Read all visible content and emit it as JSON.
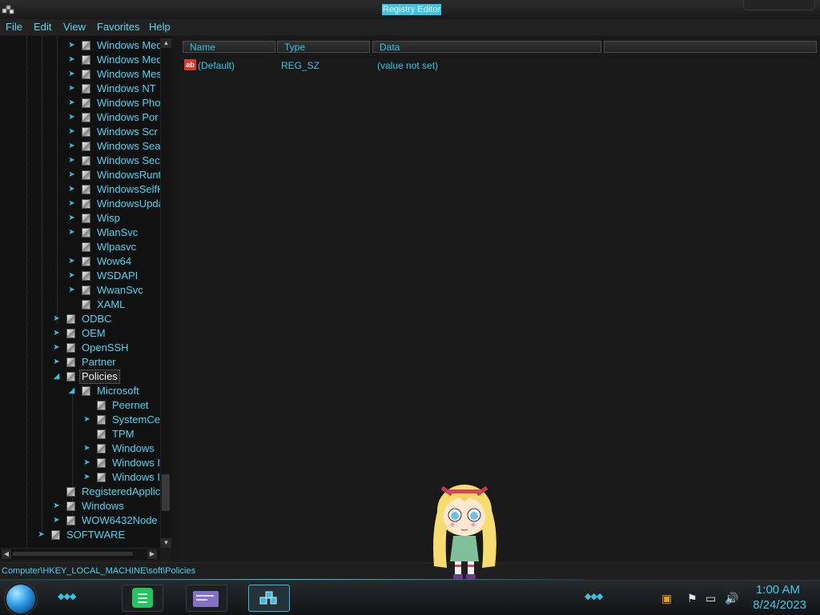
{
  "window": {
    "title": "Registry Editor"
  },
  "menu": [
    "File",
    "Edit",
    "View",
    "Favorites",
    "Help"
  ],
  "tree": {
    "nodes": [
      {
        "label": "Windows Med",
        "depth": 3,
        "expander": "collapsed"
      },
      {
        "label": "Windows Med",
        "depth": 3,
        "expander": "collapsed"
      },
      {
        "label": "Windows Mes",
        "depth": 3,
        "expander": "collapsed"
      },
      {
        "label": "Windows NT",
        "depth": 3,
        "expander": "collapsed"
      },
      {
        "label": "Windows Pho",
        "depth": 3,
        "expander": "collapsed"
      },
      {
        "label": "Windows Por",
        "depth": 3,
        "expander": "collapsed"
      },
      {
        "label": "Windows Scr",
        "depth": 3,
        "expander": "collapsed"
      },
      {
        "label": "Windows Sea",
        "depth": 3,
        "expander": "collapsed"
      },
      {
        "label": "Windows Sec",
        "depth": 3,
        "expander": "collapsed"
      },
      {
        "label": "WindowsRunt",
        "depth": 3,
        "expander": "collapsed"
      },
      {
        "label": "WindowsSelfH",
        "depth": 3,
        "expander": "collapsed"
      },
      {
        "label": "WindowsUpda",
        "depth": 3,
        "expander": "collapsed"
      },
      {
        "label": "Wisp",
        "depth": 3,
        "expander": "collapsed"
      },
      {
        "label": "WlanSvc",
        "depth": 3,
        "expander": "collapsed"
      },
      {
        "label": "Wlpasvc",
        "depth": 3,
        "expander": "none"
      },
      {
        "label": "Wow64",
        "depth": 3,
        "expander": "collapsed"
      },
      {
        "label": "WSDAPI",
        "depth": 3,
        "expander": "collapsed"
      },
      {
        "label": "WwanSvc",
        "depth": 3,
        "expander": "collapsed"
      },
      {
        "label": "XAML",
        "depth": 3,
        "expander": "none"
      },
      {
        "label": "ODBC",
        "depth": 2,
        "expander": "collapsed"
      },
      {
        "label": "OEM",
        "depth": 2,
        "expander": "collapsed"
      },
      {
        "label": "OpenSSH",
        "depth": 2,
        "expander": "collapsed"
      },
      {
        "label": "Partner",
        "depth": 2,
        "expander": "collapsed"
      },
      {
        "label": "Policies",
        "depth": 2,
        "expander": "expanded",
        "selected": true
      },
      {
        "label": "Microsoft",
        "depth": 3,
        "expander": "expanded"
      },
      {
        "label": "Peernet",
        "depth": 4,
        "expander": "none"
      },
      {
        "label": "SystemCe",
        "depth": 4,
        "expander": "collapsed"
      },
      {
        "label": "TPM",
        "depth": 4,
        "expander": "none"
      },
      {
        "label": "Windows",
        "depth": 4,
        "expander": "collapsed"
      },
      {
        "label": "Windows I",
        "depth": 4,
        "expander": "collapsed"
      },
      {
        "label": "Windows I",
        "depth": 4,
        "expander": "collapsed"
      },
      {
        "label": "RegisteredApplic",
        "depth": 2,
        "expander": "none"
      },
      {
        "label": "Windows",
        "depth": 2,
        "expander": "collapsed"
      },
      {
        "label": "WOW6432Node",
        "depth": 2,
        "expander": "collapsed"
      },
      {
        "label": "SOFTWARE",
        "depth": 1,
        "expander": "collapsed"
      }
    ]
  },
  "list": {
    "columns": [
      "Name",
      "Type",
      "Data"
    ],
    "rows": [
      {
        "icon": "string-value-icon",
        "icon_text": "ab",
        "name": "(Default)",
        "type": "REG_SZ",
        "data": "(value not set)"
      }
    ]
  },
  "status": {
    "path": "Computer\\HKEY_LOCAL_MACHINE\\soft\\Policies"
  },
  "taskbar": {
    "time": "1:00 AM",
    "date": "8/24/2023",
    "apps": [
      "notes-app-icon",
      "card-app-icon",
      "registry-editor-icon"
    ],
    "tray_icons": [
      "app-tray-icon",
      "flag-icon",
      "network-icon",
      "volume-icon"
    ]
  },
  "colors": {
    "accent": "#3ccbeb",
    "background": "#1b1b1b",
    "title_highlight": "#38c6e8"
  }
}
